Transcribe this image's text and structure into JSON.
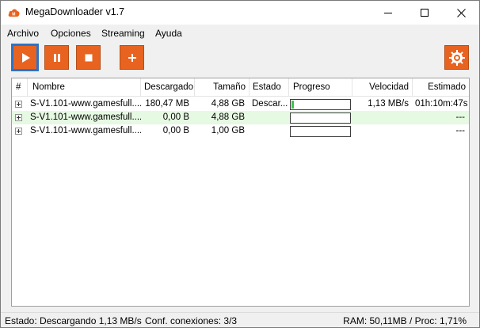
{
  "window": {
    "title": "MegaDownloader v1.7",
    "controls": {
      "minimize": "—",
      "maximize": "☐",
      "close": "✕"
    }
  },
  "menu": [
    "Archivo",
    "Opciones",
    "Streaming",
    "Ayuda"
  ],
  "toolbar": {
    "accent": "#e8631f",
    "buttons": [
      "play-icon",
      "pause-icon",
      "stop-icon",
      "plus-icon",
      "gear-icon"
    ]
  },
  "list": {
    "columns": [
      "#",
      "Nombre",
      "Descargado",
      "Tamaño",
      "Estado",
      "Progreso",
      "Velocidad",
      "Estimado"
    ],
    "rows": [
      {
        "name": "S-V1.101-www.gamesfull....",
        "downloaded": "180,47 MB",
        "size": "4,88 GB",
        "status": "Descar...",
        "progress": 0.037,
        "speed": "1,13 MB/s",
        "eta": "01h:10m:47s"
      },
      {
        "name": "S-V1.101-www.gamesfull....",
        "downloaded": "0,00 B",
        "size": "4,88 GB",
        "status": "",
        "progress": 0,
        "speed": "",
        "eta": "---"
      },
      {
        "name": "S-V1.101-www.gamesfull....",
        "downloaded": "0,00 B",
        "size": "1,00 GB",
        "status": "",
        "progress": 0,
        "speed": "",
        "eta": "---"
      }
    ]
  },
  "status": {
    "left": "Estado: Descargando 1,13 MB/s",
    "connections": "Conf. conexiones: 3/3",
    "right": "RAM: 50,11MB / Proc: 1,71%"
  }
}
